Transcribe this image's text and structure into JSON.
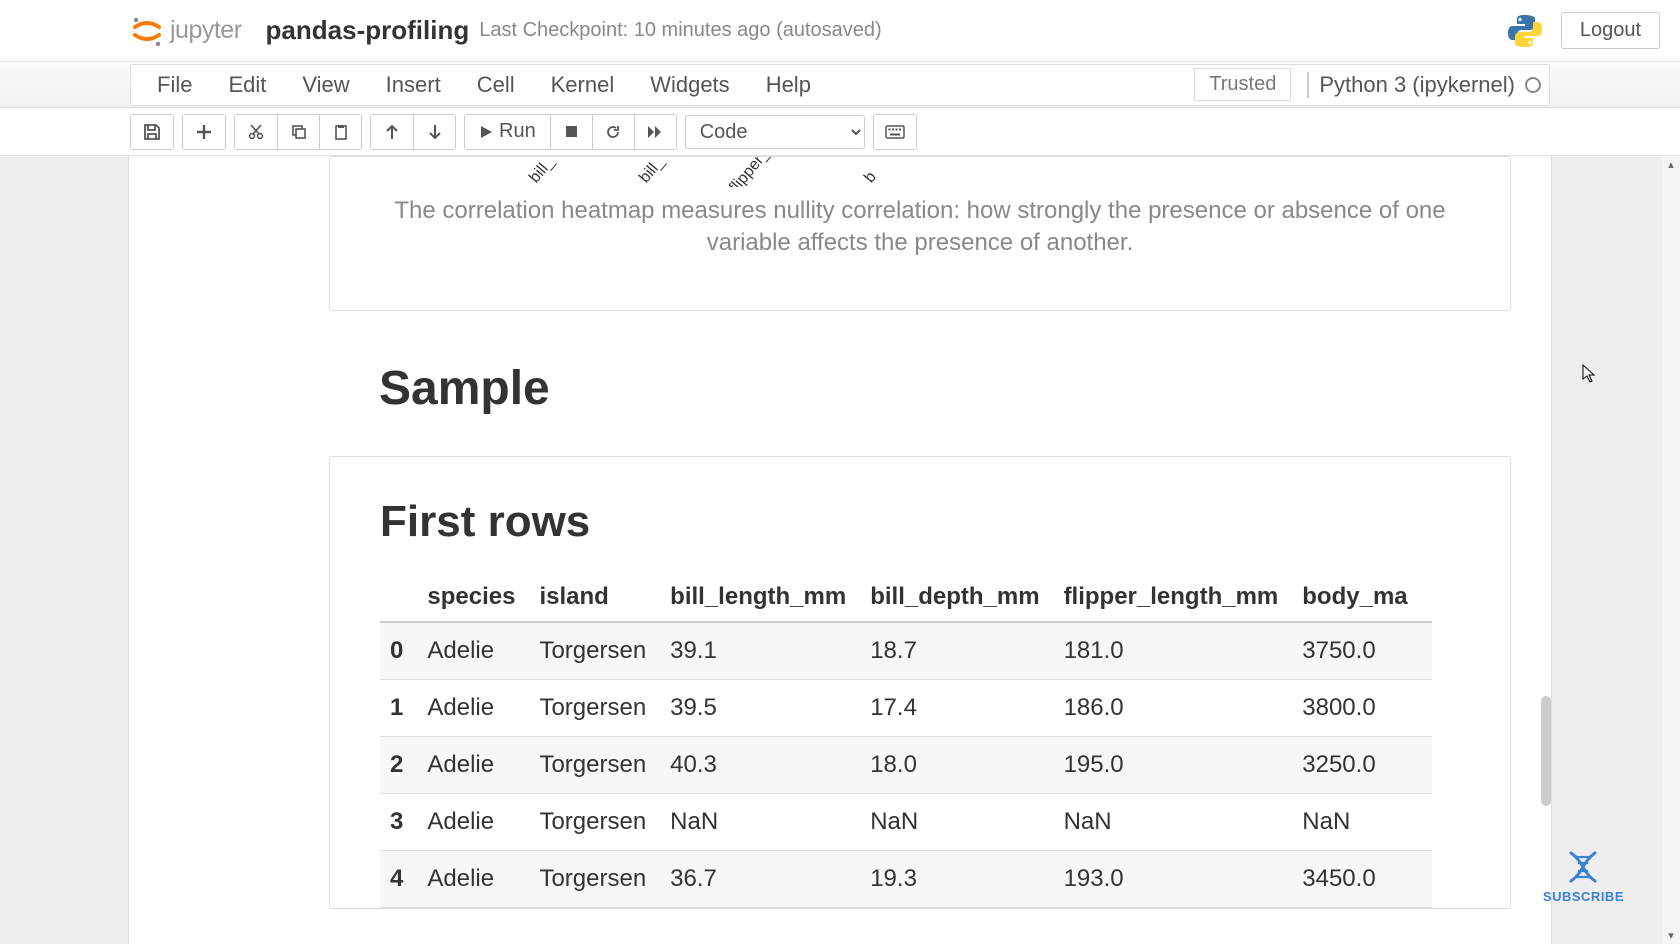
{
  "header": {
    "logo_text": "jupyter",
    "notebook_name": "pandas-profiling",
    "checkpoint": "Last Checkpoint: 10 minutes ago  (autosaved)",
    "logout": "Logout"
  },
  "menu": {
    "items": [
      "File",
      "Edit",
      "View",
      "Insert",
      "Cell",
      "Kernel",
      "Widgets",
      "Help"
    ],
    "trusted": "Trusted",
    "kernel": "Python 3 (ipykernel)"
  },
  "toolbar": {
    "run_label": "Run",
    "cell_type": "Code"
  },
  "output": {
    "heatmap_labels": [
      "bill_",
      "bill_",
      "flipper_",
      "b"
    ],
    "corr_text": "The correlation heatmap measures nullity correlation: how strongly the presence or absence of one variable affects the presence of another."
  },
  "sample": {
    "heading": "Sample",
    "first_rows_heading": "First rows",
    "columns": [
      "",
      "species",
      "island",
      "bill_length_mm",
      "bill_depth_mm",
      "flipper_length_mm",
      "body_ma"
    ],
    "rows": [
      {
        "idx": "0",
        "species": "Adelie",
        "island": "Torgersen",
        "bill_length_mm": "39.1",
        "bill_depth_mm": "18.7",
        "flipper_length_mm": "181.0",
        "body_ma": "3750.0"
      },
      {
        "idx": "1",
        "species": "Adelie",
        "island": "Torgersen",
        "bill_length_mm": "39.5",
        "bill_depth_mm": "17.4",
        "flipper_length_mm": "186.0",
        "body_ma": "3800.0"
      },
      {
        "idx": "2",
        "species": "Adelie",
        "island": "Torgersen",
        "bill_length_mm": "40.3",
        "bill_depth_mm": "18.0",
        "flipper_length_mm": "195.0",
        "body_ma": "3250.0"
      },
      {
        "idx": "3",
        "species": "Adelie",
        "island": "Torgersen",
        "bill_length_mm": "NaN",
        "bill_depth_mm": "NaN",
        "flipper_length_mm": "NaN",
        "body_ma": "NaN"
      },
      {
        "idx": "4",
        "species": "Adelie",
        "island": "Torgersen",
        "bill_length_mm": "36.7",
        "bill_depth_mm": "19.3",
        "flipper_length_mm": "193.0",
        "body_ma": "3450.0"
      }
    ]
  },
  "subscribe": "SUBSCRIBE"
}
